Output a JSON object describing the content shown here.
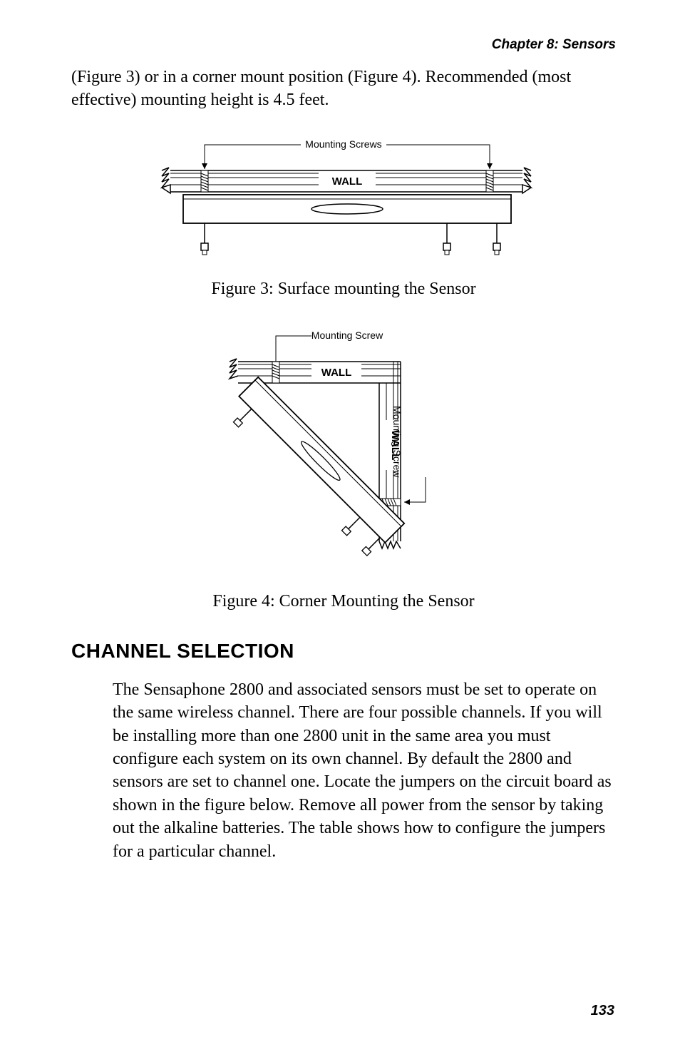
{
  "chapter_header": "Chapter 8: Sensors",
  "intro_paragraph": "(Figure 3) or in a corner mount position (Figure 4). Recommended (most effective) mounting height is 4.5 feet.",
  "figure3": {
    "label_mounting_screws": "Mounting Screws",
    "label_wall": "WALL",
    "caption": "Figure 3: Surface mounting the Sensor"
  },
  "figure4": {
    "label_mounting_screw_top": "Mounting Screw",
    "label_wall_top": "WALL",
    "label_wall_right": "WALL",
    "label_mounting_screw_right": "Mounting Screw",
    "caption": "Figure 4: Corner Mounting the Sensor"
  },
  "section_heading": "CHANNEL SELECTION",
  "body_paragraph": "The Sensaphone 2800 and associated sensors must be set to operate on the same wireless channel. There are four possible channels. If you will be installing more than one 2800 unit in the same area you must configure each system on its own channel. By default the 2800 and sensors are set to channel one. Locate the jumpers on the circuit board as shown in the figure below. Remove all power from the sensor by taking out the alkaline batteries. The table shows how to configure the jumpers for a particular channel.",
  "page_number": "133"
}
